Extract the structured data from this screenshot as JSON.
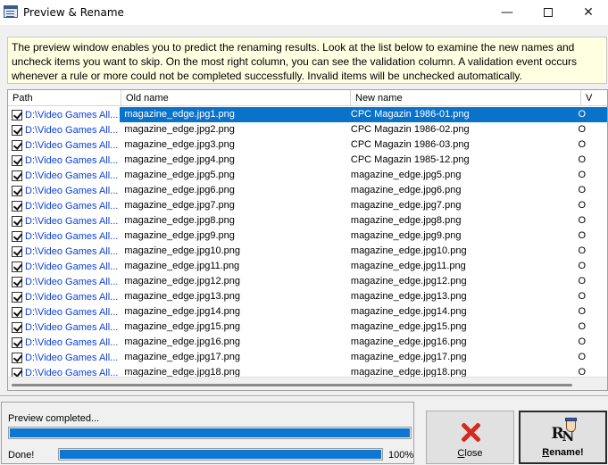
{
  "window": {
    "title": "Preview & Rename",
    "minimize_glyph": "—",
    "close_glyph": "✕"
  },
  "info_text": "The preview window enables you to predict the renaming results. Look at the list below to examine the new names and uncheck items you want to skip. On the most right column, you can see the validation column. A validation event occurs whenever a rule or more could not be completed successfully. Invalid items will be unchecked automatically.",
  "list": {
    "columns": {
      "path": "Path",
      "old": "Old name",
      "new": "New name",
      "v": "V"
    },
    "rows": [
      {
        "path": "D:\\Video Games All...",
        "old": "magazine_edge.jpg1.png",
        "new": "CPC Magazin 1986-01.png",
        "v": "O",
        "checked": true,
        "selected": true
      },
      {
        "path": "D:\\Video Games All...",
        "old": "magazine_edge.jpg2.png",
        "new": "CPC Magazin 1986-02.png",
        "v": "O",
        "checked": true
      },
      {
        "path": "D:\\Video Games All...",
        "old": "magazine_edge.jpg3.png",
        "new": "CPC Magazin 1986-03.png",
        "v": "O",
        "checked": true
      },
      {
        "path": "D:\\Video Games All...",
        "old": "magazine_edge.jpg4.png",
        "new": "CPC Magazin 1985-12.png",
        "v": "O",
        "checked": true
      },
      {
        "path": "D:\\Video Games All...",
        "old": "magazine_edge.jpg5.png",
        "new": "magazine_edge.jpg5.png",
        "v": "O",
        "checked": true
      },
      {
        "path": "D:\\Video Games All...",
        "old": "magazine_edge.jpg6.png",
        "new": "magazine_edge.jpg6.png",
        "v": "O",
        "checked": true
      },
      {
        "path": "D:\\Video Games All...",
        "old": "magazine_edge.jpg7.png",
        "new": "magazine_edge.jpg7.png",
        "v": "O",
        "checked": true
      },
      {
        "path": "D:\\Video Games All...",
        "old": "magazine_edge.jpg8.png",
        "new": "magazine_edge.jpg8.png",
        "v": "O",
        "checked": true
      },
      {
        "path": "D:\\Video Games All...",
        "old": "magazine_edge.jpg9.png",
        "new": "magazine_edge.jpg9.png",
        "v": "O",
        "checked": true
      },
      {
        "path": "D:\\Video Games All...",
        "old": "magazine_edge.jpg10.png",
        "new": "magazine_edge.jpg10.png",
        "v": "O",
        "checked": true
      },
      {
        "path": "D:\\Video Games All...",
        "old": "magazine_edge.jpg11.png",
        "new": "magazine_edge.jpg11.png",
        "v": "O",
        "checked": true
      },
      {
        "path": "D:\\Video Games All...",
        "old": "magazine_edge.jpg12.png",
        "new": "magazine_edge.jpg12.png",
        "v": "O",
        "checked": true
      },
      {
        "path": "D:\\Video Games All...",
        "old": "magazine_edge.jpg13.png",
        "new": "magazine_edge.jpg13.png",
        "v": "O",
        "checked": true
      },
      {
        "path": "D:\\Video Games All...",
        "old": "magazine_edge.jpg14.png",
        "new": "magazine_edge.jpg14.png",
        "v": "O",
        "checked": true
      },
      {
        "path": "D:\\Video Games All...",
        "old": "magazine_edge.jpg15.png",
        "new": "magazine_edge.jpg15.png",
        "v": "O",
        "checked": true
      },
      {
        "path": "D:\\Video Games All...",
        "old": "magazine_edge.jpg16.png",
        "new": "magazine_edge.jpg16.png",
        "v": "O",
        "checked": true
      },
      {
        "path": "D:\\Video Games All...",
        "old": "magazine_edge.jpg17.png",
        "new": "magazine_edge.jpg17.png",
        "v": "O",
        "checked": true
      },
      {
        "path": "D:\\Video Games All...",
        "old": "magazine_edge.jpg18.png",
        "new": "magazine_edge.jpg18.png",
        "v": "O",
        "checked": true
      }
    ]
  },
  "status": {
    "message": "Preview completed...",
    "progress1": 1.0,
    "done_label": "Done!",
    "progress2": 1.0,
    "percent_text": "100%"
  },
  "buttons": {
    "close": {
      "label_underlined": "C",
      "label_rest": "lose",
      "icon": "close-x-icon"
    },
    "rename": {
      "label_underlined": "R",
      "label_rest": "ename!",
      "icon": "rn-rename-icon"
    }
  },
  "colors": {
    "selection": "#0a72c9",
    "path_text": "#0b3fd6",
    "progress": "#0c78d4",
    "info_bg": "#ffffe1",
    "close_x": "#d42a1f"
  }
}
